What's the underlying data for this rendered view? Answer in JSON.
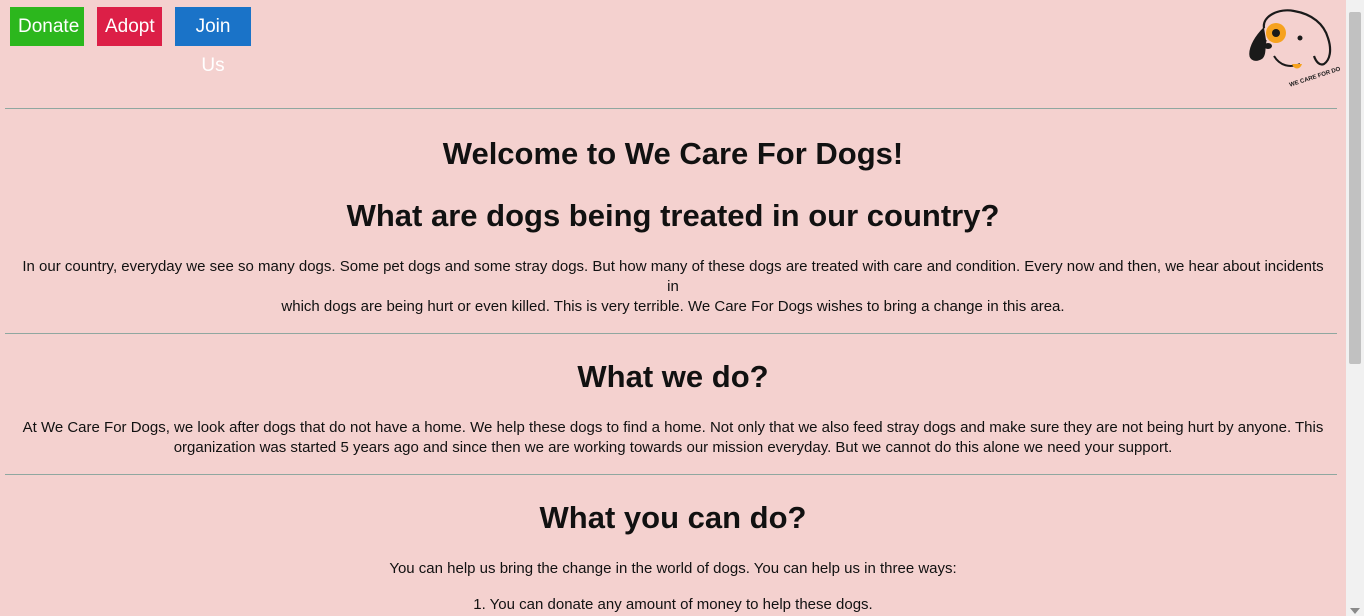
{
  "nav": {
    "donate_label": "Donate",
    "adopt_label": "Adopt",
    "join_label": "Join Us"
  },
  "logo": {
    "text": "WE CARE FOR DOGS"
  },
  "welcome": {
    "title": "Welcome to We Care For Dogs!"
  },
  "treatment": {
    "title": "What are dogs being treated in our country?",
    "line1": "In our country, everyday we see so many dogs. Some pet dogs and some stray dogs. But how many of these dogs are treated with care and condition. Every now and then, we hear about incidents in",
    "line2": "which dogs are being hurt or even killed. This is very terrible. We Care For Dogs wishes to bring a change in this area."
  },
  "what_we_do": {
    "title": "What we do?",
    "line1": "At We Care For Dogs, we look after dogs that do not have a home. We help these dogs to find a home. Not only that we also feed stray dogs and make sure they are not being hurt by anyone. This",
    "line2": "organization was started 5 years ago and since then we are working towards our mission everyday. But we cannot do this alone we need your support."
  },
  "what_you_can_do": {
    "title": "What you can do?",
    "intro": "You can help us bring the change in the world of dogs. You can help us in three ways:",
    "items": [
      "1. You can donate any amount of money to help these dogs."
    ]
  },
  "colors": {
    "background": "#f4d1cf",
    "donate": "#2cb71d",
    "adopt": "#dc1f47",
    "join": "#1a73c8"
  }
}
